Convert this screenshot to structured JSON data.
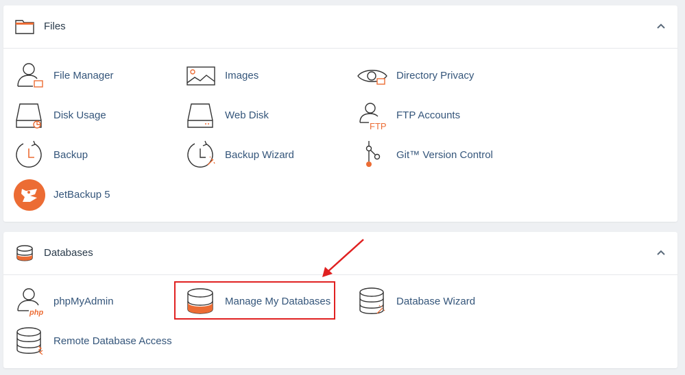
{
  "colors": {
    "accent": "#ec6c34",
    "link": "#34557a",
    "heading": "#293a4a",
    "highlight": "#e02020"
  },
  "sections": {
    "files": {
      "title": "Files",
      "icon": "folder-icon",
      "items": [
        {
          "label": "File Manager",
          "icon": "file-manager-icon"
        },
        {
          "label": "Images",
          "icon": "images-icon"
        },
        {
          "label": "Directory Privacy",
          "icon": "directory-privacy-icon"
        },
        {
          "label": "Disk Usage",
          "icon": "disk-usage-icon"
        },
        {
          "label": "Web Disk",
          "icon": "web-disk-icon"
        },
        {
          "label": "FTP Accounts",
          "icon": "ftp-accounts-icon"
        },
        {
          "label": "Backup",
          "icon": "backup-icon"
        },
        {
          "label": "Backup Wizard",
          "icon": "backup-wizard-icon"
        },
        {
          "label": "Git™ Version Control",
          "icon": "git-icon"
        },
        {
          "label": "JetBackup 5",
          "icon": "jetbackup-icon"
        }
      ]
    },
    "databases": {
      "title": "Databases",
      "icon": "database-icon",
      "items": [
        {
          "label": "phpMyAdmin",
          "icon": "phpmyadmin-icon"
        },
        {
          "label": "Manage My Databases",
          "icon": "manage-databases-icon"
        },
        {
          "label": "Database Wizard",
          "icon": "database-wizard-icon"
        },
        {
          "label": "Remote Database Access",
          "icon": "remote-database-icon"
        }
      ]
    }
  },
  "ftp_badge": "FTP",
  "php_badge": "php"
}
